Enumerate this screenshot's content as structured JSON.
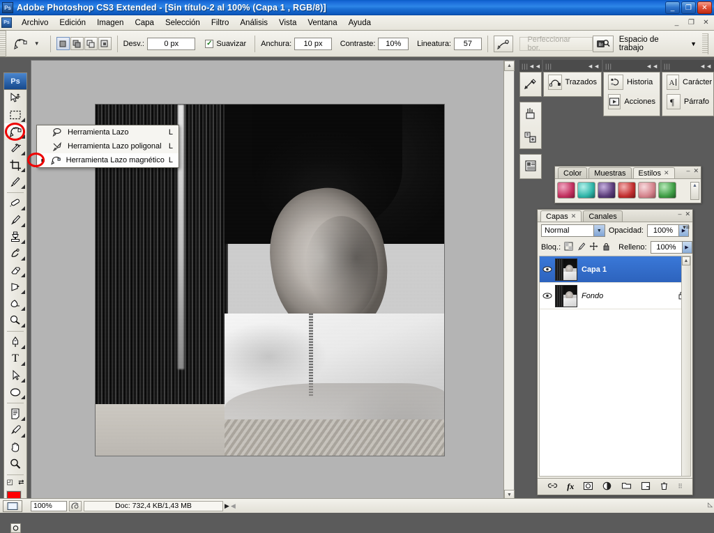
{
  "window": {
    "title": "Adobe Photoshop CS3 Extended - [Sin título-2 al 100% (Capa 1 , RGB/8)]",
    "app_badge": "Ps",
    "buttons": {
      "minimize": "_",
      "restore": "❐",
      "close": "✕"
    },
    "doc_buttons": {
      "minimize": "_",
      "restore": "❐",
      "close": "✕"
    }
  },
  "menubar": {
    "doc_badge": "Ps",
    "items": [
      {
        "label": "Archivo"
      },
      {
        "label": "Edición"
      },
      {
        "label": "Imagen"
      },
      {
        "label": "Capa"
      },
      {
        "label": "Selección"
      },
      {
        "label": "Filtro"
      },
      {
        "label": "Análisis"
      },
      {
        "label": "Vista"
      },
      {
        "label": "Ventana"
      },
      {
        "label": "Ayuda"
      }
    ]
  },
  "options_bar": {
    "tool_preset_icon": "magnetic-lasso-icon",
    "dropdown_caret": "▼",
    "selection_modes": [
      "new-selection",
      "add-to-selection",
      "subtract-from-selection",
      "intersect-selection"
    ],
    "desv_label": "Desv.:",
    "desv_value": "0 px",
    "suavizar_label": "Suavizar",
    "suavizar_checked": "✓",
    "anchura_label": "Anchura:",
    "anchura_value": "10 px",
    "contraste_label": "Contraste:",
    "contraste_value": "10%",
    "lineatura_label": "Lineatura:",
    "lineatura_value": "57",
    "tablet_pressure_icon": "pen-pressure-icon",
    "refine_edge_label": "Perfeccionar bor.",
    "bridge_icon": "bridge-icon",
    "workspace_label": "Espacio de trabajo",
    "workspace_caret": "▼"
  },
  "toolbox": {
    "header": "Ps",
    "tools": [
      {
        "name": "move-tool",
        "key": "V"
      },
      {
        "name": "rectangular-marquee-tool",
        "key": "M"
      },
      {
        "name": "lasso-tool",
        "key": "L"
      },
      {
        "name": "magic-wand-tool",
        "key": "W"
      },
      {
        "name": "crop-tool",
        "key": "C"
      },
      {
        "name": "slice-tool",
        "key": "K"
      },
      {
        "name": "healing-brush-tool",
        "key": "J"
      },
      {
        "name": "brush-tool",
        "key": "B"
      },
      {
        "name": "clone-stamp-tool",
        "key": "S"
      },
      {
        "name": "history-brush-tool",
        "key": "Y"
      },
      {
        "name": "eraser-tool",
        "key": "E"
      },
      {
        "name": "gradient-tool",
        "key": "G"
      },
      {
        "name": "blur-tool",
        "key": "R"
      },
      {
        "name": "dodge-tool",
        "key": "O"
      },
      {
        "name": "pen-tool",
        "key": "P"
      },
      {
        "name": "type-tool",
        "key": "T"
      },
      {
        "name": "path-selection-tool",
        "key": "A"
      },
      {
        "name": "ellipse-shape-tool",
        "key": "U"
      },
      {
        "name": "notes-tool",
        "key": "N"
      },
      {
        "name": "eyedropper-tool",
        "key": "I"
      },
      {
        "name": "hand-tool",
        "key": "H"
      },
      {
        "name": "zoom-tool",
        "key": "Z"
      }
    ],
    "type_glyph": "T",
    "foreground_color": "#fe0000",
    "background_color": "#000000",
    "default_colors_glyph": "◰",
    "swap_colors_glyph": "⇄"
  },
  "flyout": {
    "items": [
      {
        "icon": "lasso-icon",
        "label": "Herramienta Lazo",
        "key": "L",
        "bullet": "",
        "selected": false
      },
      {
        "icon": "polygonal-lasso-icon",
        "label": "Herramienta Lazo poligonal",
        "key": "L",
        "bullet": "",
        "selected": false
      },
      {
        "icon": "magnetic-lasso-icon",
        "label": "Herramienta Lazo magnético",
        "key": "L",
        "bullet": "■",
        "selected": true
      }
    ]
  },
  "dock": {
    "strips": [
      "|||",
      "|||",
      "|||",
      "|||"
    ],
    "collapse_glyph": "◄◄",
    "icon_column": [
      {
        "name": "tool-presets-icon"
      },
      {
        "name": "brushes-icon"
      },
      {
        "name": "clone-source-icon"
      },
      {
        "name": "layer-comps-icon"
      }
    ],
    "groups": [
      {
        "buttons": [
          {
            "icon": "paths-icon",
            "label": "Trazados"
          }
        ]
      },
      {
        "buttons": [
          {
            "icon": "history-icon",
            "label": "Historia"
          },
          {
            "icon": "actions-icon",
            "label": "Acciones"
          }
        ]
      },
      {
        "buttons": [
          {
            "icon": "character-icon",
            "label": "Carácter"
          },
          {
            "icon": "paragraph-icon",
            "label": "Párrafo"
          }
        ]
      }
    ]
  },
  "styles_panel": {
    "tabs": [
      {
        "label": "Color",
        "active": false,
        "closable": false
      },
      {
        "label": "Muestras",
        "active": false,
        "closable": false
      },
      {
        "label": "Estilos",
        "active": true,
        "closable": true
      }
    ],
    "close_x": "✕",
    "minimize": "–",
    "menu_glyph": "▾≡",
    "swatches": [
      "#c2315f",
      "#2fb5a8",
      "#5b3d7a",
      "#c22f2f",
      "#d4838c",
      "#3f9e45"
    ]
  },
  "layers_panel": {
    "tabs": [
      {
        "label": "Capas",
        "active": true,
        "closable": true
      },
      {
        "label": "Canales",
        "active": false,
        "closable": false
      }
    ],
    "close_x": "✕",
    "minimize": "–",
    "menu_glyph": "▾≡",
    "blend_mode": "Normal",
    "opacity_label": "Opacidad:",
    "opacity_value": "100%",
    "lock_label": "Bloq.:",
    "lock_icons": [
      "lock-transparent-pixels-icon",
      "lock-image-pixels-icon",
      "lock-position-icon",
      "lock-all-icon"
    ],
    "fill_label": "Relleno:",
    "fill_value": "100%",
    "layers": [
      {
        "name": "Capa 1",
        "selected": true,
        "visible": true,
        "locked": false,
        "italic": false
      },
      {
        "name": "Fondo",
        "selected": false,
        "visible": true,
        "locked": true,
        "italic": true
      }
    ],
    "eye_glyph": "👁",
    "lock_glyph": "🔒",
    "footer_buttons": [
      {
        "name": "link-layers-icon",
        "glyph": "⛓"
      },
      {
        "name": "layer-style-fx-icon",
        "glyph": "fx"
      },
      {
        "name": "add-layer-mask-icon",
        "glyph": "◻"
      },
      {
        "name": "new-adjustment-layer-icon",
        "glyph": "◐"
      },
      {
        "name": "new-group-icon",
        "glyph": "🗀"
      },
      {
        "name": "new-layer-icon",
        "glyph": "❐"
      },
      {
        "name": "delete-layer-icon",
        "glyph": "🗑"
      }
    ]
  },
  "status_bar": {
    "zoom_value": "100%",
    "proxy_icon": "preview-icon",
    "doc_info": "Doc: 732,4 KB/1,43 MB",
    "expand_arrow": "▶",
    "resize_grip": "◺"
  },
  "annotations": [
    {
      "name": "lasso-tool-highlight",
      "color": "#ee0000"
    },
    {
      "name": "magnetic-lasso-bullet-highlight",
      "color": "#ee0000"
    }
  ]
}
